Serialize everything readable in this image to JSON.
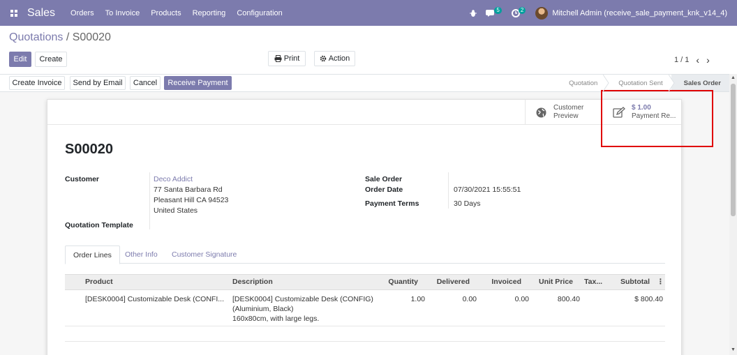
{
  "navbar": {
    "app_name": "Sales",
    "menu": [
      "Orders",
      "To Invoice",
      "Products",
      "Reporting",
      "Configuration"
    ],
    "messages_count": "5",
    "activities_count": "2",
    "user": "Mitchell Admin (receive_sale_payment_knk_v14_4)",
    "color": "#7c7bad"
  },
  "breadcrumb": {
    "parent": "Quotations",
    "separator": " / ",
    "current": "S00020"
  },
  "toolbar": {
    "edit_label": "Edit",
    "create_label": "Create",
    "print_label": "Print",
    "action_label": "Action",
    "pager": "1 / 1"
  },
  "header_buttons": {
    "create_invoice": "Create Invoice",
    "send_by_email": "Send by Email",
    "cancel": "Cancel",
    "receive_payment": "Receive Payment"
  },
  "stages": [
    {
      "label": "Quotation",
      "active": false
    },
    {
      "label": "Quotation Sent",
      "active": false
    },
    {
      "label": "Sales Order",
      "active": true
    }
  ],
  "smart_buttons": {
    "preview_line1": "Customer",
    "preview_line2": "Preview",
    "payment_value": "$ 1.00",
    "payment_label": "Payment Re..."
  },
  "order": {
    "name": "S00020",
    "customer_label": "Customer",
    "customer_name": "Deco Addict",
    "address_line1": "77 Santa Barbara Rd",
    "address_line2": "Pleasant Hill CA 94523",
    "address_line3": "United States",
    "template_label": "Quotation Template",
    "sale_order_label": "Sale Order",
    "order_date_label": "Order Date",
    "order_date": "07/30/2021 15:55:51",
    "payment_terms_label": "Payment Terms",
    "payment_terms": "30 Days"
  },
  "tabs": [
    "Order Lines",
    "Other Info",
    "Customer Signature"
  ],
  "table": {
    "headers": {
      "product": "Product",
      "description": "Description",
      "quantity": "Quantity",
      "delivered": "Delivered",
      "invoiced": "Invoiced",
      "unit_price": "Unit Price",
      "taxes": "Tax...",
      "subtotal": "Subtotal"
    },
    "rows": [
      {
        "product": "[DESK0004] Customizable Desk (CONFI...",
        "description_1": "[DESK0004] Customizable Desk (CONFIG)",
        "description_2": "(Aluminium, Black)",
        "description_3": "160x80cm, with large legs.",
        "quantity": "1.00",
        "delivered": "0.00",
        "invoiced": "0.00",
        "unit_price": "800.40",
        "subtotal": "$ 800.40"
      }
    ]
  }
}
